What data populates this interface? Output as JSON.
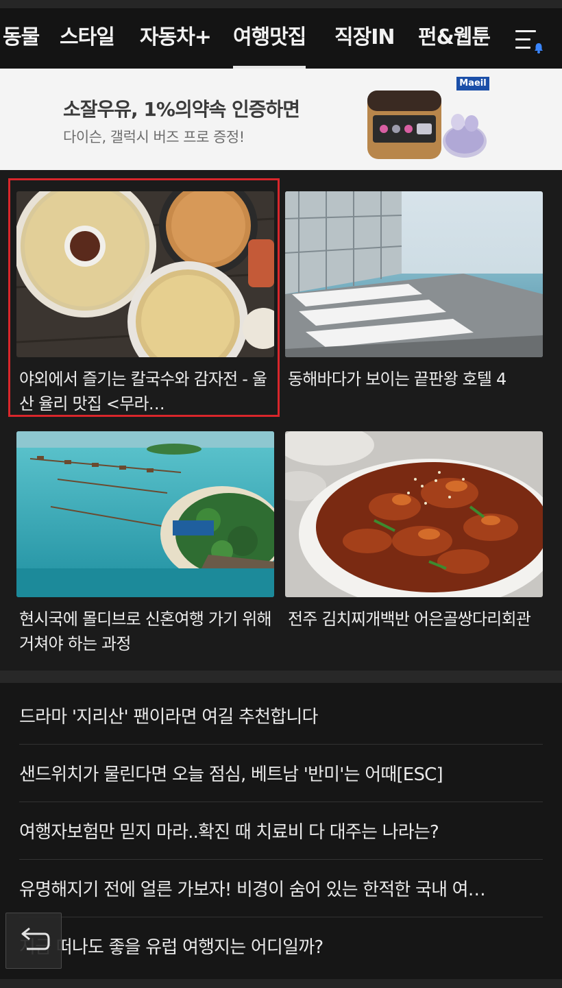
{
  "tabs": [
    {
      "label": "동물",
      "active": false
    },
    {
      "label": "스타일",
      "active": false
    },
    {
      "label": "자동차+",
      "active": false
    },
    {
      "label": "여행맛집",
      "active": true
    },
    {
      "label": "직장IN",
      "active": false
    },
    {
      "label": "펀&웹툰",
      "active": false
    }
  ],
  "ad": {
    "title": "소잘우유, 1%의약속 인증하면",
    "subtitle": "다이슨, 갤럭시 버즈 프로 증정!",
    "brand": "Maeil"
  },
  "cards": [
    {
      "caption": "야외에서 즐기는 칼국수와 감자전 - 울산 율리 맛집 <무라…",
      "image": "noodle-soup-photo",
      "highlighted": true
    },
    {
      "caption": "동해바다가 보이는 끝판왕 호텔 4",
      "image": "hotel-pool-sea-photo",
      "highlighted": false
    },
    {
      "caption": "현시국에 몰디브로 신혼여행 가기 위해 거쳐야 하는 과정",
      "image": "maldives-island-photo",
      "highlighted": false
    },
    {
      "caption": "전주 김치찌개백반 어은골쌍다리회관",
      "image": "spicy-pork-dish-photo",
      "highlighted": false
    }
  ],
  "list": [
    "드라마 '지리산' 팬이라면 여길 추천합니다",
    "샌드위치가 물린다면 오늘 점심, 베트남 '반미'는 어때[ESC]",
    "여행자보험만 믿지 마라..확진 때 치료비 다 대주는 나라는?",
    "유명해지기 전에 얼른 가보자! 비경이 숨어 있는 한적한 국내 여…",
    "지금 떠나도 좋을 유럽 여행지는 어디일까?"
  ],
  "icons": {
    "menu": "menu-bell-icon",
    "back": "back-arrow-icon"
  },
  "colors": {
    "highlight": "#d9262b",
    "notification": "#3a86ff",
    "brand": "#1b4fa8"
  }
}
